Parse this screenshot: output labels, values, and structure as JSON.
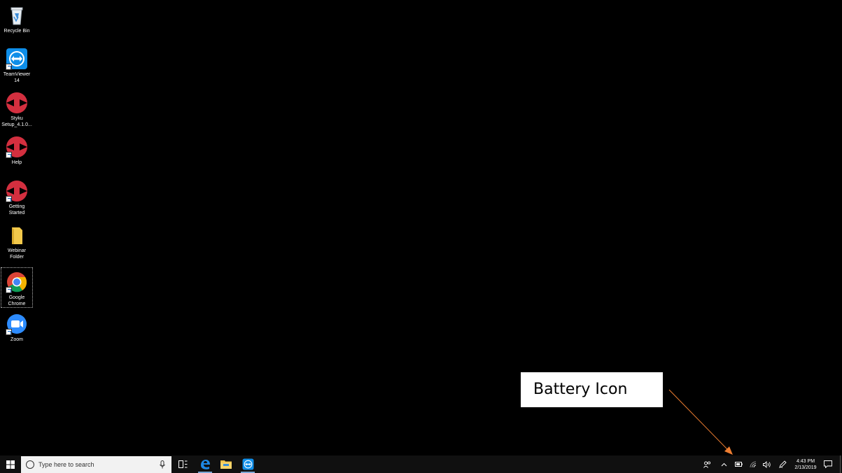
{
  "desktop": {
    "icons": [
      {
        "name": "recycle-bin",
        "label": "Recycle Bin"
      },
      {
        "name": "teamviewer",
        "label": "TeamViewer\n14"
      },
      {
        "name": "styku-setup",
        "label": "Styku\nSetup_4.1.0..."
      },
      {
        "name": "help",
        "label": "Help"
      },
      {
        "name": "getting-started",
        "label": "Getting\nStarted"
      },
      {
        "name": "webinar-folder",
        "label": "Webinar\nFolder"
      },
      {
        "name": "google-chrome",
        "label": "Google\nChrome"
      },
      {
        "name": "zoom",
        "label": "Zoom"
      }
    ]
  },
  "annotation": {
    "label": "Battery Icon",
    "color": "#ed7d31"
  },
  "taskbar": {
    "search_placeholder": "Type here to search",
    "pinned": [
      "task-view-icon",
      "edge-icon",
      "file-explorer-icon",
      "teamviewer-icon"
    ],
    "tray": {
      "time": "4:43 PM",
      "date": "2/13/2019"
    }
  },
  "colors": {
    "taskbar_bg": "#101010",
    "accent_blue": "#0078d7",
    "styku_red": "#d32f3f"
  }
}
